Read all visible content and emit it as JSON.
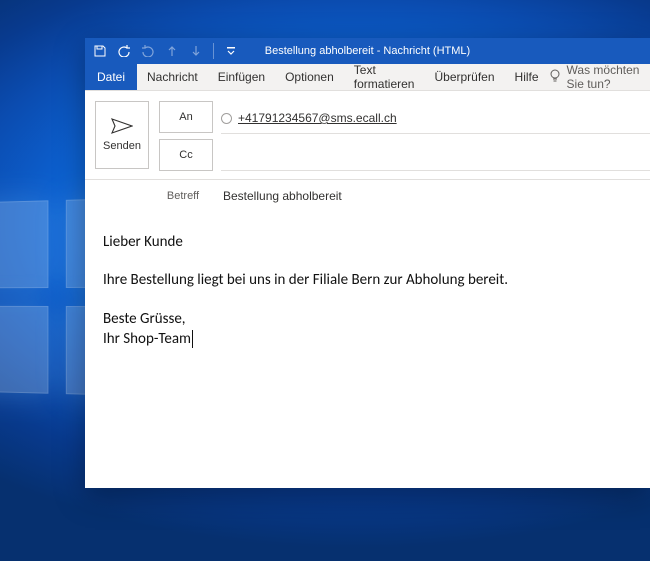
{
  "window": {
    "title_full": "Bestellung abholbereit - Nachricht (HTML)"
  },
  "qa": {
    "customize_tooltip": "Customize Quick Access Toolbar"
  },
  "ribbon": {
    "file": "Datei",
    "message": "Nachricht",
    "insert": "Einfügen",
    "options": "Optionen",
    "format": "Text formatieren",
    "review": "Überprüfen",
    "help": "Hilfe",
    "tell_me": "Was möchten Sie tun?"
  },
  "header": {
    "send": "Senden",
    "to": "An",
    "cc": "Cc",
    "subject_label": "Betreff",
    "to_value": "+41791234567@sms.ecall.ch",
    "subject_value": "Bestellung abholbereit"
  },
  "body": {
    "greeting": "Lieber Kunde",
    "line1": "Ihre Bestellung liegt bei uns in der Filiale Bern zur Abholung bereit.",
    "signoff1": "Beste Grüsse,",
    "signoff2": "Ihr Shop-Team"
  }
}
